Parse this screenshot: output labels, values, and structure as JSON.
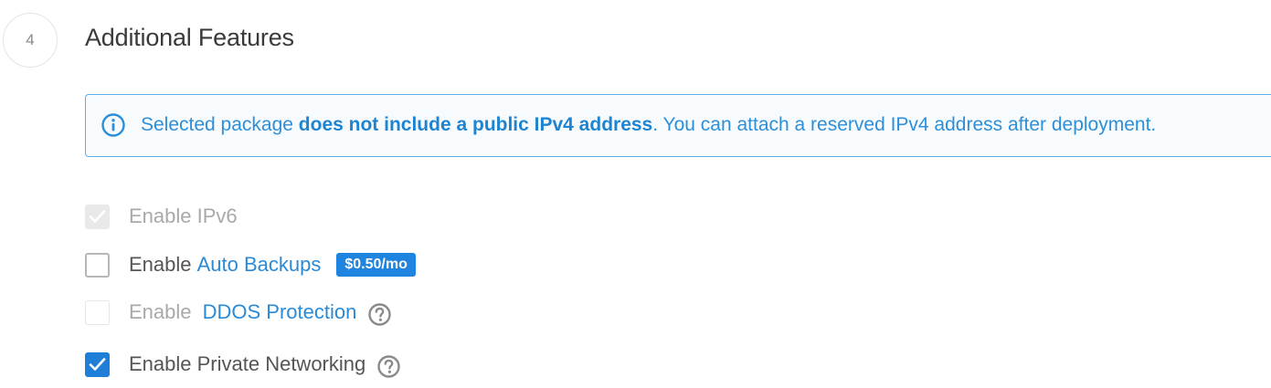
{
  "step": {
    "number": "4",
    "title": "Additional Features"
  },
  "notice": {
    "prefix": "Selected package ",
    "bold": "does not include a public IPv4 address",
    "suffix": ". You can attach a reserved IPv4 address after deployment.",
    "icon": "info-circle-icon"
  },
  "options": {
    "ipv6": {
      "label": "Enable IPv6",
      "checked": true,
      "disabled": true
    },
    "backups": {
      "prefix": "Enable ",
      "link": "Auto Backups",
      "price": "$0.50/mo",
      "checked": false,
      "disabled": false
    },
    "ddos": {
      "prefix": "Enable ",
      "link": "DDOS Protection",
      "checked": false,
      "disabled": true,
      "icon": "help-circle-icon"
    },
    "private_net": {
      "label": "Enable Private Networking",
      "checked": true,
      "disabled": false,
      "icon": "help-circle-icon"
    }
  },
  "colors": {
    "accent": "#1f7fd8",
    "notice_border": "#5bb0e6",
    "notice_text": "#2c8fd8"
  }
}
